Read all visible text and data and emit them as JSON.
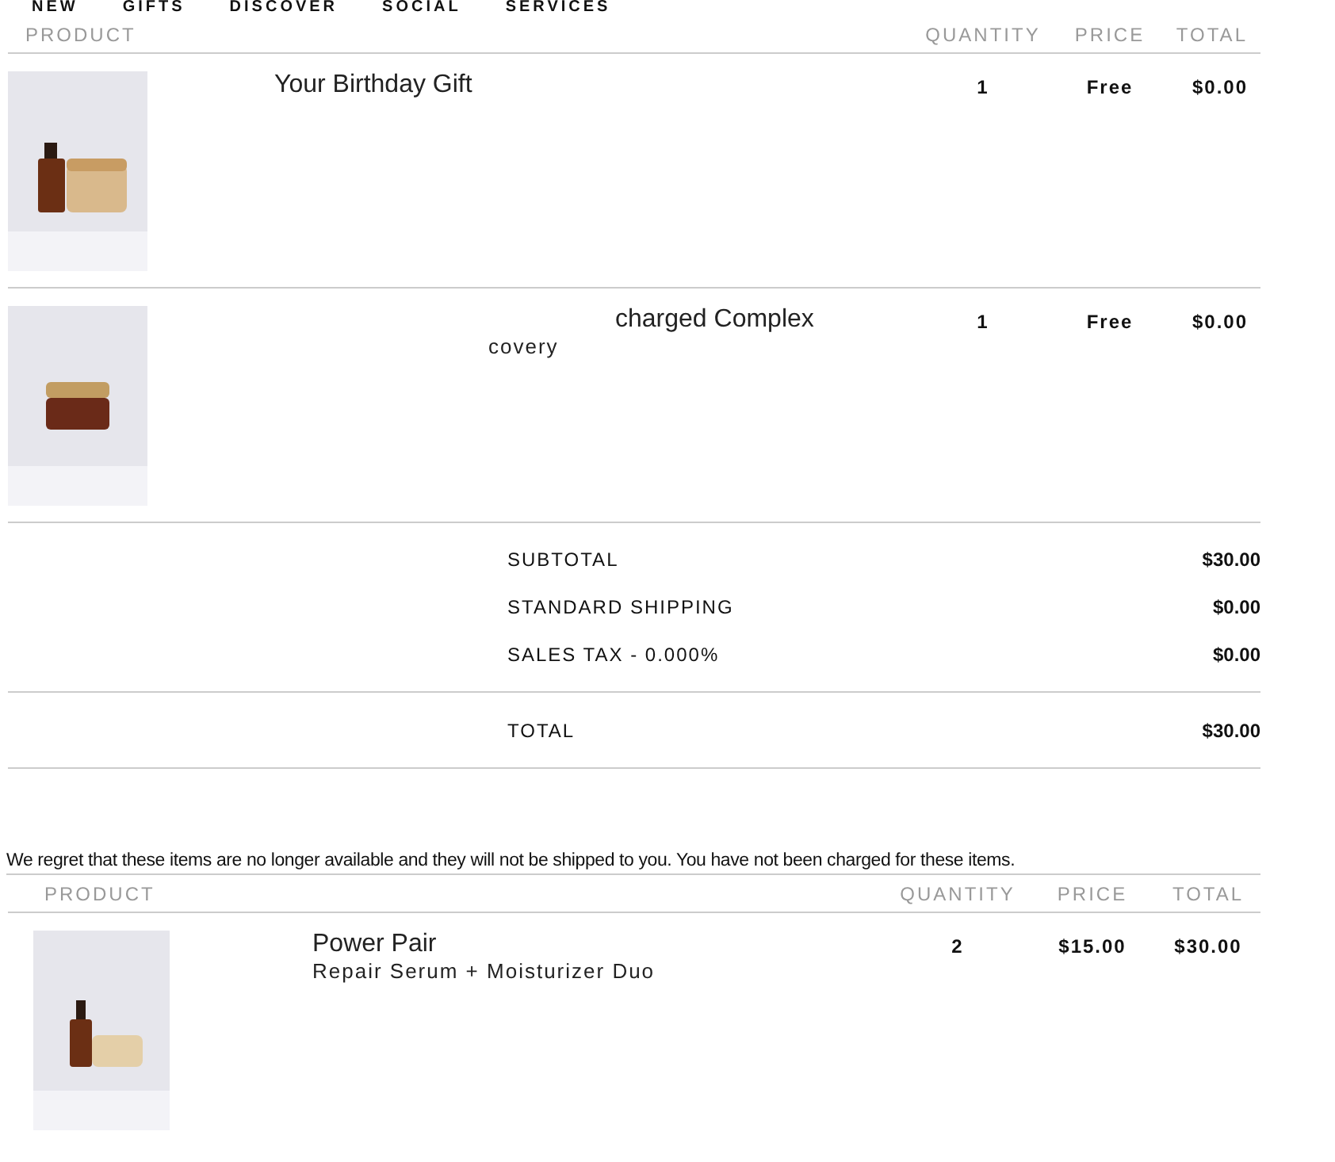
{
  "nav": [
    "NEW",
    "GIFTS",
    "DISCOVER",
    "SOCIAL",
    "SERVICES"
  ],
  "order": {
    "columns": [
      "PRODUCT",
      "QUANTITY",
      "PRICE",
      "TOTAL"
    ],
    "rows": [
      {
        "name": "Your Birthday Gift",
        "subtitle": "",
        "partial": false,
        "quantity": "1",
        "price": "Free",
        "total": "$0.00",
        "kind": "jar-pair"
      },
      {
        "name": "charged Complex",
        "subtitle": "covery",
        "partial": true,
        "quantity": "1",
        "price": "Free",
        "total": "$0.00",
        "kind": "jar"
      }
    ]
  },
  "summary": [
    {
      "label": "SUBTOTAL",
      "value": "$30.00",
      "kind": "line"
    },
    {
      "label": "STANDARD SHIPPING",
      "value": "$0.00",
      "kind": "line"
    },
    {
      "label": "SALES TAX - 0.000%",
      "value": "$0.00",
      "kind": "line"
    },
    {
      "label": "TOTAL",
      "value": "$30.00",
      "kind": "total"
    }
  ],
  "notice": "We regret that these items are no longer available and they will not be shipped to you. You have not been charged for these items.",
  "unavailable": {
    "columns": [
      "PRODUCT",
      "QUANTITY",
      "PRICE",
      "TOTAL"
    ],
    "rows": [
      {
        "name": "Power Pair",
        "subtitle": "Repair Serum + Moisturizer Duo",
        "quantity": "2",
        "price": "$15.00",
        "total": "$30.00"
      }
    ]
  }
}
